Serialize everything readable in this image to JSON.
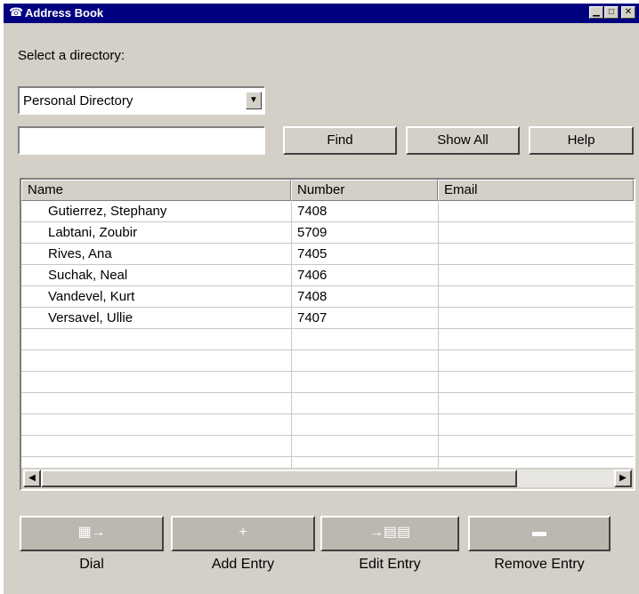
{
  "window": {
    "title": "Address Book",
    "icon": "telephone-icon",
    "controls": {
      "minimize": "minimize-icon",
      "maximize": "maximize-icon",
      "close": "close-icon"
    }
  },
  "directory": {
    "label": "Select a directory:",
    "selected": "Personal Directory"
  },
  "search": {
    "value": "",
    "placeholder": ""
  },
  "buttons": {
    "find": "Find",
    "show_all": "Show All",
    "help": "Help"
  },
  "table": {
    "columns": [
      "Name",
      "Number",
      "Email"
    ],
    "rows": [
      {
        "name": "Gutierrez, Stephany",
        "number": "7408",
        "email": ""
      },
      {
        "name": "Labtani, Zoubir",
        "number": "5709",
        "email": ""
      },
      {
        "name": "Rives, Ana",
        "number": "7405",
        "email": ""
      },
      {
        "name": "Suchak, Neal",
        "number": "7406",
        "email": ""
      },
      {
        "name": "Vandevel, Kurt",
        "number": "7408",
        "email": ""
      },
      {
        "name": "Versavel, Ullie",
        "number": "7407",
        "email": ""
      }
    ]
  },
  "actions": {
    "dial": "Dial",
    "add_entry": "Add Entry",
    "edit_entry": "Edit Entry",
    "remove_entry": "Remove Entry"
  }
}
